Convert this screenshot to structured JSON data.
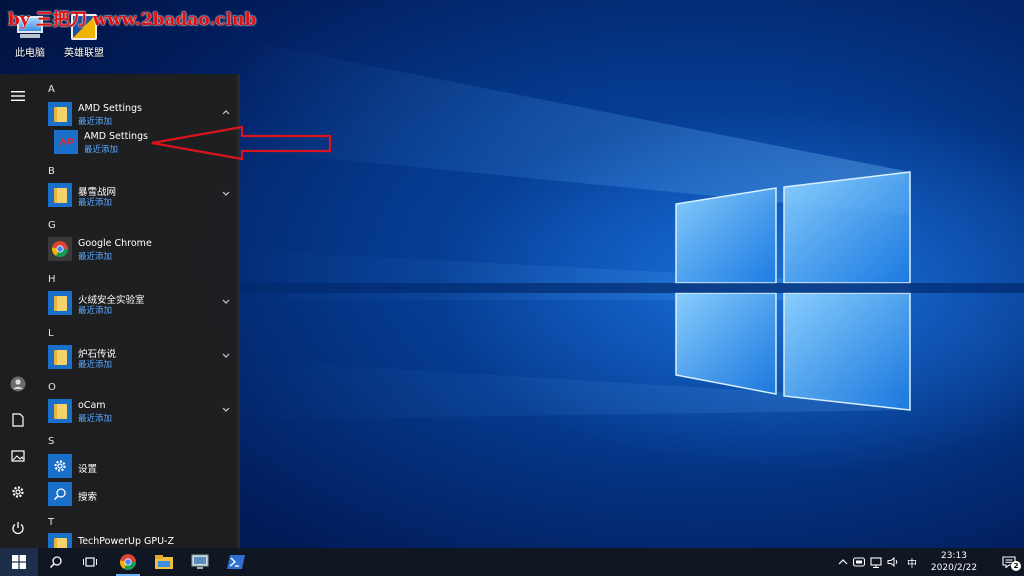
{
  "watermark": "by 三把刀 www.2badao.club",
  "desktop": {
    "icons": [
      {
        "label": "此电脑",
        "icon": "computer-icon"
      },
      {
        "label": "英雄联盟",
        "icon": "league-of-legends-icon"
      }
    ]
  },
  "start_menu": {
    "sections": [
      {
        "letter": "A"
      },
      {
        "letter": "B"
      },
      {
        "letter": "G"
      },
      {
        "letter": "H"
      },
      {
        "letter": "L"
      },
      {
        "letter": "O"
      },
      {
        "letter": "S"
      },
      {
        "letter": "T"
      }
    ],
    "apps": {
      "amd_folder": {
        "name": "AMD Settings",
        "sub": "最近添加"
      },
      "amd_app": {
        "name": "AMD Settings",
        "sub": "最近添加"
      },
      "blizzard": {
        "name": "暴雪战网",
        "sub": "最近添加"
      },
      "chrome": {
        "name": "Google Chrome",
        "sub": "最近添加"
      },
      "huorong": {
        "name": "火绒安全实验室",
        "sub": "最近添加"
      },
      "hearthstone": {
        "name": "炉石传说",
        "sub": "最近添加"
      },
      "ocam": {
        "name": "oCam",
        "sub": "最近添加"
      },
      "settings": {
        "name": "设置"
      },
      "search": {
        "name": "搜索"
      },
      "gpuz": {
        "name": "TechPowerUp GPU-Z"
      }
    }
  },
  "taskbar": {
    "ime": "中",
    "time": "23:13",
    "date": "2020/2/22",
    "notification_count": "2"
  },
  "colors": {
    "accent": "#1a6fc8",
    "annotation_arrow": "#d8141c",
    "sub_text": "#5aa9ff"
  }
}
